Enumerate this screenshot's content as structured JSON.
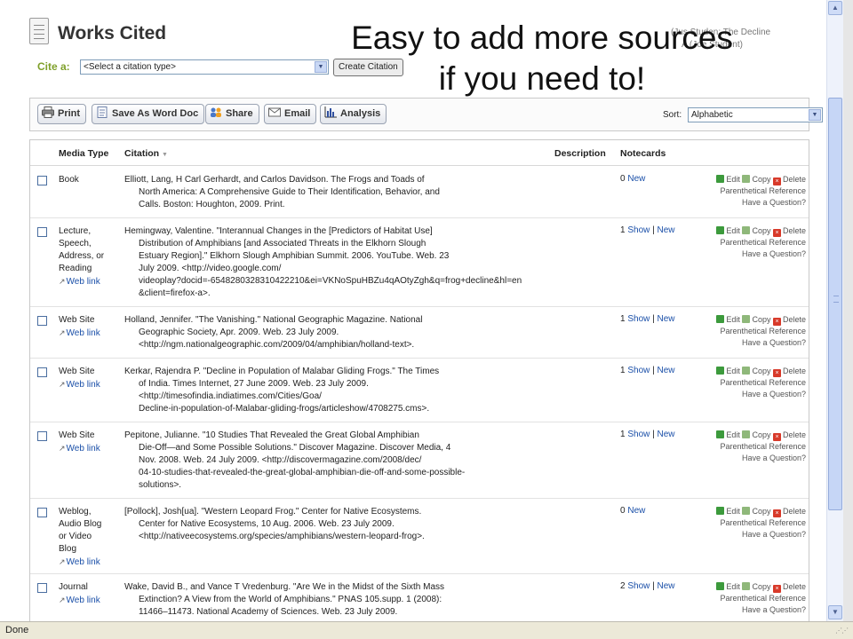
{
  "header": {
    "title": "Works Cited",
    "user_line1": "(Jus Studen: The Decline",
    "user_line2": "A (Joe Student)",
    "overlay_line1": "Easy to add more sources",
    "overlay_line2": "if you need to!"
  },
  "cite": {
    "label": "Cite a:",
    "select_value": "<Select a citation type>",
    "create_label": "Create Citation"
  },
  "toolbar": {
    "print": "Print",
    "word": "Save As Word Doc",
    "share": "Share",
    "email": "Email",
    "analysis": "Analysis",
    "sort_label": "Sort:",
    "sort_value": "Alphabetic"
  },
  "table": {
    "columns": {
      "media": "Media Type",
      "citation": "Citation",
      "sort_arrow": "▼",
      "description": "Description",
      "notecards": "Notecards"
    },
    "actions": {
      "edit": "Edit",
      "copy": "Copy",
      "delete": "Delete",
      "parenthetical": "Parenthetical Reference",
      "question": "Have a Question?"
    },
    "web_link": "Web link",
    "rows": [
      {
        "media_lines": [
          "Book"
        ],
        "web_link": false,
        "citation_lines": [
          "Elliott, Lang, H Carl Gerhardt, and Carlos Davidson. The Frogs and Toads of",
          "North America: A Comprehensive Guide to Their Identification, Behavior, and",
          "Calls. Boston: Houghton, 2009. Print."
        ],
        "count": "0",
        "show": "",
        "new": "New"
      },
      {
        "media_lines": [
          "Lecture,",
          "Speech,",
          "Address, or",
          "Reading"
        ],
        "web_link": true,
        "citation_lines": [
          "Hemingway, Valentine. \"Interannual Changes in the [Predictors of Habitat Use]",
          "Distribution of Amphibians [and Associated Threats in the Elkhorn Slough",
          "Estuary Region].\" Elkhorn Slough Amphibian Summit. 2006. YouTube. Web. 23",
          "July 2009. <http://video.google.com/",
          "videoplay?docid=-6548280328310422210&ei=VKNoSpuHBZu4qAOtyZgh&q=frog+decline&hl=en",
          "&client=firefox-a>."
        ],
        "count": "1",
        "show": "Show",
        "new": "New"
      },
      {
        "media_lines": [
          "Web Site"
        ],
        "web_link": true,
        "citation_lines": [
          "Holland, Jennifer. \"The Vanishing.\" National Geographic Magazine. National",
          "Geographic Society, Apr. 2009. Web. 23 July 2009.",
          "<http://ngm.nationalgeographic.com/2009/04/amphibian/holland-text>."
        ],
        "count": "1",
        "show": "Show",
        "new": "New"
      },
      {
        "media_lines": [
          "Web Site"
        ],
        "web_link": true,
        "citation_lines": [
          "Kerkar, Rajendra P. \"Decline in Population of Malabar Gliding Frogs.\" The Times",
          "of India. Times Internet, 27 June 2009. Web. 23 July 2009.",
          "<http://timesofindia.indiatimes.com/Cities/Goa/",
          "Decline-in-population-of-Malabar-gliding-frogs/articleshow/4708275.cms>."
        ],
        "count": "1",
        "show": "Show",
        "new": "New"
      },
      {
        "media_lines": [
          "Web Site"
        ],
        "web_link": true,
        "citation_lines": [
          "Pepitone, Julianne. \"10 Studies That Revealed the Great Global Amphibian",
          "Die-Off—and Some Possible Solutions.\" Discover Magazine. Discover Media, 4",
          "Nov. 2008. Web. 24 July 2009. <http://discovermagazine.com/2008/dec/",
          "04-10-studies-that-revealed-the-great-global-amphibian-die-off-and-some-possible-",
          "solutions>."
        ],
        "count": "1",
        "show": "Show",
        "new": "New"
      },
      {
        "media_lines": [
          "Weblog,",
          "Audio Blog",
          "or Video",
          "Blog"
        ],
        "web_link": true,
        "citation_lines": [
          "[Pollock], Josh[ua]. \"Western Leopard Frog.\" Center for Native Ecosystems.",
          "Center for Native Ecosystems, 10 Aug. 2006. Web. 23 July 2009.",
          "<http://nativeecosystems.org/species/amphibians/western-leopard-frog>."
        ],
        "count": "0",
        "show": "",
        "new": "New"
      },
      {
        "media_lines": [
          "Journal"
        ],
        "web_link": true,
        "citation_lines": [
          "Wake, David B., and Vance T Vredenburg. \"Are We in the Midst of the Sixth Mass",
          "Extinction? A View from the World of Amphibians.\" PNAS 105.supp. 1 (2008):",
          "11466–11473. National Academy of Sciences. Web. 23 July 2009."
        ],
        "count": "2",
        "show": "Show",
        "new": "New"
      }
    ]
  },
  "status": {
    "text": "Done"
  }
}
